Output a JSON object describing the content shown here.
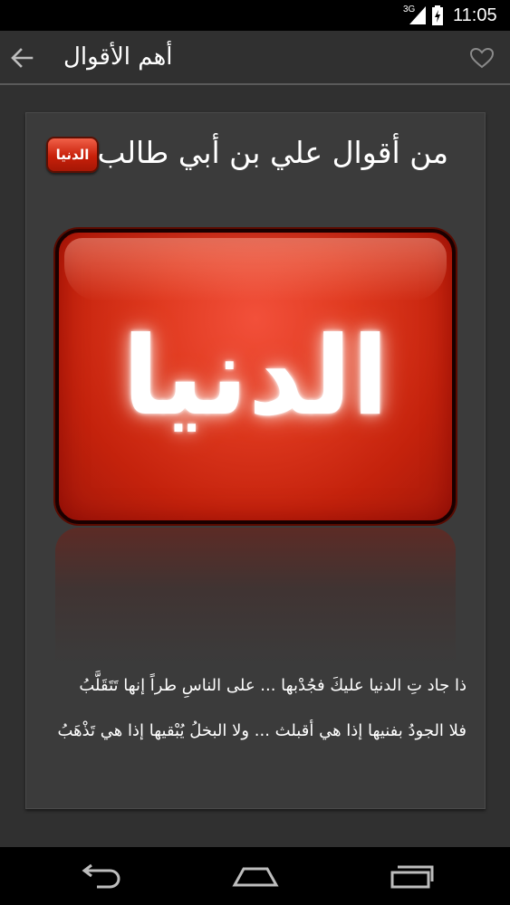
{
  "status_bar": {
    "network": "3G",
    "time": "11:05"
  },
  "action_bar": {
    "title": "أهم الأقوال"
  },
  "card": {
    "badge_text": "الدنيا",
    "title": "من أقوال علي بن أبي طالب",
    "hero_word": "الدنيا",
    "verses": [
      "ذا جاد تِ الدنيا عليكَ فجُدْبها ... على الناسِ طراً إنها تَتَقَلَّبُ",
      "فلا الجودُ بفنيها إذا هي أقبلث ... ولا البخلُ يُبْقيها إذا هي تَذْهَبُ"
    ]
  },
  "colors": {
    "background": "#303030",
    "card": "#3b3b3b",
    "accent_red": "#d0301a"
  },
  "icons": {
    "back": "arrow-left-icon",
    "favorite": "heart-outline-icon",
    "nav_back": "nav-back-icon",
    "nav_home": "nav-home-icon",
    "nav_recent": "nav-recent-icon"
  }
}
